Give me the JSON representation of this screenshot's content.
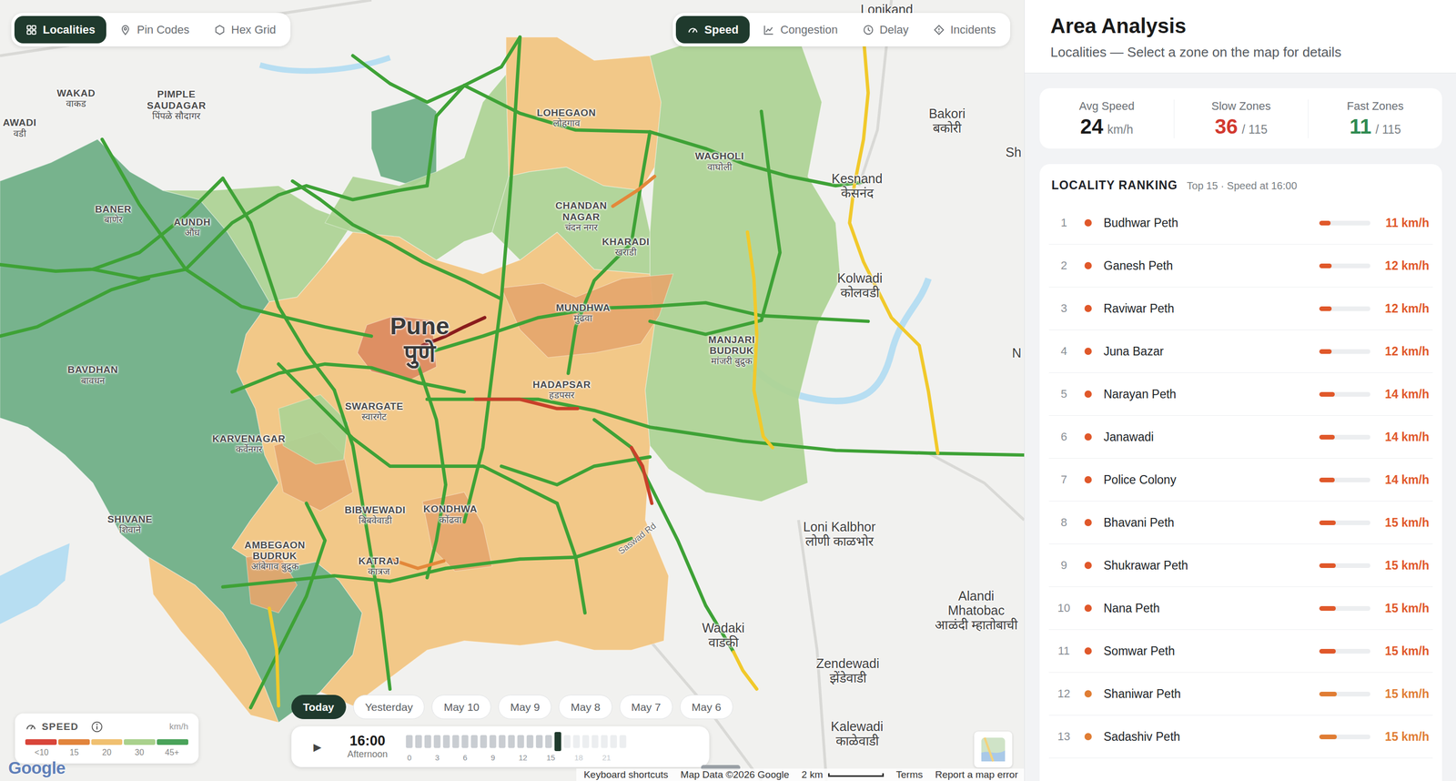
{
  "map_toolbar": {
    "views": [
      {
        "label": "Localities",
        "selected": true
      },
      {
        "label": "Pin Codes",
        "selected": false
      },
      {
        "label": "Hex Grid",
        "selected": false
      }
    ],
    "metrics": [
      {
        "label": "Speed",
        "selected": true
      },
      {
        "label": "Congestion",
        "selected": false
      },
      {
        "label": "Delay",
        "selected": false
      },
      {
        "label": "Incidents",
        "selected": false
      }
    ]
  },
  "map": {
    "places": [
      {
        "name": "AWADI",
        "local": "वडी",
        "kind": "area"
      },
      {
        "name": "WAKAD",
        "local": "वाकड",
        "kind": "area"
      },
      {
        "name": "PIMPLE SAUDAGAR",
        "local": "पिंपळे सौदागर",
        "kind": "area"
      },
      {
        "name": "BANER",
        "local": "बाणेर",
        "kind": "area"
      },
      {
        "name": "AUNDH",
        "local": "औंध",
        "kind": "area"
      },
      {
        "name": "BAVDHAN",
        "local": "बावधन",
        "kind": "area"
      },
      {
        "name": "KARVENAGAR",
        "local": "कर्वेनगर",
        "kind": "area"
      },
      {
        "name": "SHIVANE",
        "local": "शिवाने",
        "kind": "area"
      },
      {
        "name": "AMBEGAON BUDRUK",
        "local": "आंबेगाव बुद्रुक",
        "kind": "area"
      },
      {
        "name": "SWARGATE",
        "local": "स्वारगेट",
        "kind": "area"
      },
      {
        "name": "Pune",
        "local": "पुणे",
        "kind": "city"
      },
      {
        "name": "LOHEGAON",
        "local": "लोहगाव",
        "kind": "area"
      },
      {
        "name": "CHANDAN NAGAR",
        "local": "चंदन नगर",
        "kind": "area"
      },
      {
        "name": "KHARADI",
        "local": "खराडी",
        "kind": "area"
      },
      {
        "name": "WAGHOLI",
        "local": "वाघोली",
        "kind": "area"
      },
      {
        "name": "MUNDHWA",
        "local": "मुंढवा",
        "kind": "area"
      },
      {
        "name": "MANJARI BUDRUK",
        "local": "मांजरी बुद्रुक",
        "kind": "area"
      },
      {
        "name": "HADAPSAR",
        "local": "हडपसर",
        "kind": "area"
      },
      {
        "name": "BIBWEWADI",
        "local": "बिबवेवाडी",
        "kind": "area"
      },
      {
        "name": "KONDHWA",
        "local": "कोंढवा",
        "kind": "area"
      },
      {
        "name": "KATRAJ",
        "local": "कात्रज",
        "kind": "area"
      },
      {
        "name": "Lonikand",
        "kind": "town"
      },
      {
        "name": "Bakori",
        "local": "बकोरी",
        "kind": "town"
      },
      {
        "name": "Sh",
        "kind": "town"
      },
      {
        "name": "Kesnand",
        "local": "केसनंद",
        "kind": "town"
      },
      {
        "name": "Kolwadi",
        "local": "कोलवडी",
        "kind": "town"
      },
      {
        "name": "N",
        "kind": "town"
      },
      {
        "name": "Loni Kalbhor",
        "local": "लोणी काळभोर",
        "kind": "town"
      },
      {
        "name": "Alandi Mhatobac",
        "local": "आळंदी म्हातोबाची",
        "kind": "town"
      },
      {
        "name": "Wadaki",
        "local": "वाडकी",
        "kind": "town"
      },
      {
        "name": "Zendewadi",
        "local": "झेंडेवाडी",
        "kind": "town"
      },
      {
        "name": "Kalewadi",
        "local": "काळेवाडी",
        "kind": "town"
      },
      {
        "name": "Saswad Rd",
        "kind": "road"
      }
    ],
    "zones": [
      {
        "color": "#6dae84"
      },
      {
        "color": "#6dae84"
      },
      {
        "color": "#acd394"
      },
      {
        "color": "#f2c47f"
      },
      {
        "color": "#acd394"
      },
      {
        "color": "#f2c47f"
      },
      {
        "color": "#acd394"
      },
      {
        "color": "#acd394"
      },
      {
        "color": "#e5a66c"
      },
      {
        "color": "#dc8a5f"
      },
      {
        "color": "#e5a66c"
      },
      {
        "color": "#e5a66c"
      },
      {
        "color": "#acd394"
      },
      {
        "color": "#f2c47f"
      },
      {
        "color": "#e5a66c"
      }
    ],
    "roads": [
      {
        "color": "#3ea236"
      },
      {
        "color": "#3ea236"
      },
      {
        "color": "#3ea236"
      },
      {
        "color": "#3ea236"
      },
      {
        "color": "#3ea236"
      },
      {
        "color": "#3ea236"
      },
      {
        "color": "#3ea236"
      },
      {
        "color": "#3ea236"
      },
      {
        "color": "#3ea236"
      },
      {
        "color": "#3ea236"
      },
      {
        "color": "#3ea236"
      },
      {
        "color": "#3ea236"
      },
      {
        "color": "#3ea236"
      },
      {
        "color": "#3ea236"
      },
      {
        "color": "#3ea236"
      },
      {
        "color": "#3ea236"
      },
      {
        "color": "#3ea236"
      },
      {
        "color": "#3ea236"
      },
      {
        "color": "#3ea236"
      },
      {
        "color": "#3ea236"
      },
      {
        "color": "#3ea236"
      },
      {
        "color": "#3ea236"
      },
      {
        "color": "#3ea236"
      },
      {
        "color": "#f1c92b"
      },
      {
        "color": "#f1c92b"
      },
      {
        "color": "#f1c92b"
      },
      {
        "color": "#f1c92b"
      },
      {
        "color": "#8a1c1c"
      },
      {
        "color": "#c8402a"
      },
      {
        "color": "#c8402a"
      },
      {
        "color": "#e3883a"
      },
      {
        "color": "#e3883a"
      }
    ],
    "logo": "Google",
    "footer": {
      "shortcuts": "Keyboard shortcuts",
      "data": "Map Data ©2026 Google",
      "scale": "2 km",
      "terms": "Terms",
      "report": "Report a map error"
    }
  },
  "legend": {
    "title": "SPEED",
    "unit": "km/h",
    "segments": [
      {
        "color": "#d9453a",
        "tick": "<10"
      },
      {
        "color": "#e2843c",
        "tick": "15"
      },
      {
        "color": "#f0c070",
        "tick": "20"
      },
      {
        "color": "#a9d18c",
        "tick": "30"
      },
      {
        "color": "#4aa35a",
        "tick": "45+"
      }
    ]
  },
  "timeline": {
    "days": [
      {
        "label": "Today",
        "selected": true
      },
      {
        "label": "Yesterday",
        "selected": false
      },
      {
        "label": "May 10",
        "selected": false
      },
      {
        "label": "May 9",
        "selected": false
      },
      {
        "label": "May 8",
        "selected": false
      },
      {
        "label": "May 7",
        "selected": false
      },
      {
        "label": "May 6",
        "selected": false
      }
    ],
    "play": "▶",
    "time": "16:00",
    "period": "Afternoon",
    "slots": [
      {
        "state": "past"
      },
      {
        "state": "past"
      },
      {
        "state": "past"
      },
      {
        "state": "past"
      },
      {
        "state": "past"
      },
      {
        "state": "past"
      },
      {
        "state": "past"
      },
      {
        "state": "past"
      },
      {
        "state": "past"
      },
      {
        "state": "past"
      },
      {
        "state": "past"
      },
      {
        "state": "past"
      },
      {
        "state": "past"
      },
      {
        "state": "past"
      },
      {
        "state": "past"
      },
      {
        "state": "past"
      },
      {
        "state": "current"
      },
      {
        "state": "future"
      },
      {
        "state": "future"
      },
      {
        "state": "future"
      },
      {
        "state": "future"
      },
      {
        "state": "future"
      },
      {
        "state": "future"
      },
      {
        "state": "future"
      }
    ],
    "ticks": [
      {
        "label": "0",
        "future": false
      },
      {
        "label": "3",
        "future": false
      },
      {
        "label": "6",
        "future": false
      },
      {
        "label": "9",
        "future": false
      },
      {
        "label": "12",
        "future": false
      },
      {
        "label": "15",
        "future": false
      },
      {
        "label": "18",
        "future": true
      },
      {
        "label": "21",
        "future": true
      }
    ]
  },
  "panel": {
    "title": "Area Analysis",
    "subtitle": "Localities — Select a zone on the map for details",
    "stats": [
      {
        "label": "Avg Speed",
        "value": "24",
        "unit": "km/h",
        "color": "#1a1a1a"
      },
      {
        "label": "Slow Zones",
        "value": "36",
        "unit": "/ 115",
        "color": "#d2392f"
      },
      {
        "label": "Fast Zones",
        "value": "11",
        "unit": "/ 115",
        "color": "#2e8a50"
      }
    ],
    "ranking": {
      "title": "LOCALITY RANKING",
      "note": "Top 15 · Speed at 16:00",
      "rows": [
        {
          "rank": "1",
          "name": "Budhwar Peth",
          "speed": "11 km/h",
          "level": 0.22,
          "color": "#e0582a"
        },
        {
          "rank": "2",
          "name": "Ganesh Peth",
          "speed": "12 km/h",
          "level": 0.24,
          "color": "#e0582a"
        },
        {
          "rank": "3",
          "name": "Raviwar Peth",
          "speed": "12 km/h",
          "level": 0.24,
          "color": "#e0582a"
        },
        {
          "rank": "4",
          "name": "Juna Bazar",
          "speed": "12 km/h",
          "level": 0.24,
          "color": "#e0582a"
        },
        {
          "rank": "5",
          "name": "Narayan Peth",
          "speed": "14 km/h",
          "level": 0.3,
          "color": "#e0582a"
        },
        {
          "rank": "6",
          "name": "Janawadi",
          "speed": "14 km/h",
          "level": 0.3,
          "color": "#e0582a"
        },
        {
          "rank": "7",
          "name": "Police Colony",
          "speed": "14 km/h",
          "level": 0.3,
          "color": "#e0582a"
        },
        {
          "rank": "8",
          "name": "Bhavani Peth",
          "speed": "15 km/h",
          "level": 0.32,
          "color": "#e0582a"
        },
        {
          "rank": "9",
          "name": "Shukrawar Peth",
          "speed": "15 km/h",
          "level": 0.32,
          "color": "#e0582a"
        },
        {
          "rank": "10",
          "name": "Nana Peth",
          "speed": "15 km/h",
          "level": 0.32,
          "color": "#e0582a"
        },
        {
          "rank": "11",
          "name": "Somwar Peth",
          "speed": "15 km/h",
          "level": 0.32,
          "color": "#e0582a"
        },
        {
          "rank": "12",
          "name": "Shaniwar Peth",
          "speed": "15 km/h",
          "level": 0.34,
          "color": "#e07d34"
        },
        {
          "rank": "13",
          "name": "Sadashiv Peth",
          "speed": "15 km/h",
          "level": 0.34,
          "color": "#e07d34"
        }
      ]
    }
  }
}
